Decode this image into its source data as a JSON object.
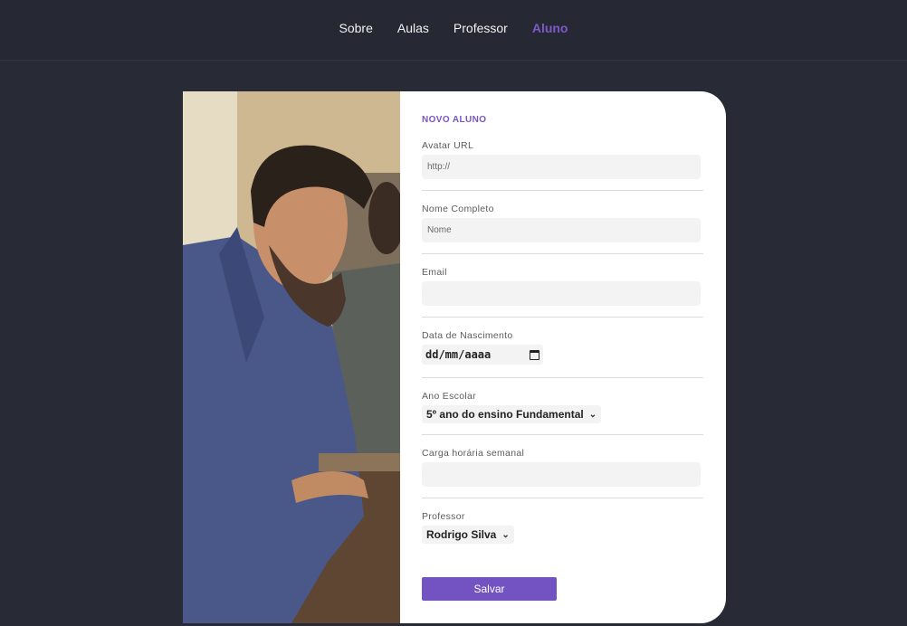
{
  "nav": {
    "items": [
      {
        "label": "Sobre",
        "active": false
      },
      {
        "label": "Aulas",
        "active": false
      },
      {
        "label": "Professor",
        "active": false
      },
      {
        "label": "Aluno",
        "active": true
      }
    ],
    "accent_color": "#7d5ac8"
  },
  "form": {
    "title": "NOVO ALUNO",
    "avatar": {
      "label": "Avatar URL",
      "placeholder": "http://",
      "value": ""
    },
    "name": {
      "label": "Nome Completo",
      "placeholder": "Nome",
      "value": ""
    },
    "email": {
      "label": "Email",
      "placeholder": "",
      "value": ""
    },
    "birth": {
      "label": "Data de Nascimento",
      "value": "dd/mm/aaaa",
      "icon": "calendar-icon"
    },
    "grade": {
      "label": "Ano Escolar",
      "selected": "5º ano do ensino Fundamental",
      "icon": "chevron-down-icon"
    },
    "hours": {
      "label": "Carga horária semanal",
      "placeholder": "",
      "value": ""
    },
    "teacher": {
      "label": "Professor",
      "selected": "Rodrigo Silva",
      "icon": "chevron-down-icon"
    },
    "save_label": "Salvar",
    "button_color": "#7253c1"
  },
  "colors": {
    "background": "#282a36",
    "card": "#ffffff"
  }
}
